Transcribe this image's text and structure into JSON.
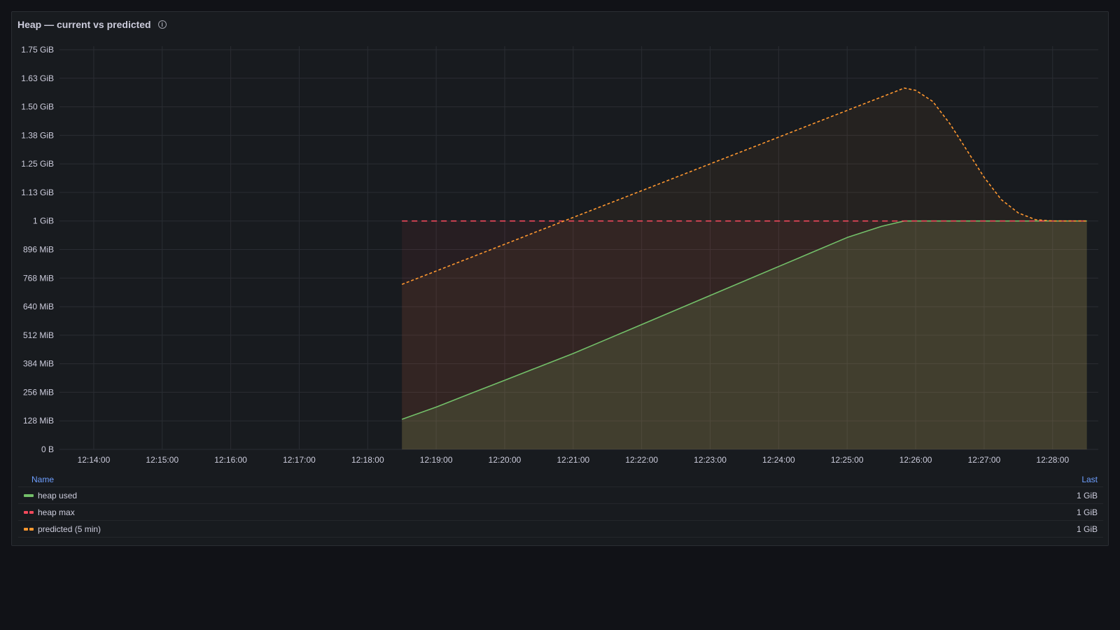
{
  "panel": {
    "title": "Heap — current vs predicted",
    "info_icon": "info-icon"
  },
  "legend": {
    "name_header": "Name",
    "last_header": "Last",
    "items": [
      {
        "name": "heap used",
        "last": "1 GiB",
        "color": "#73bf69",
        "style": "solid"
      },
      {
        "name": "heap max",
        "last": "1 GiB",
        "color": "#f2495c",
        "style": "dashed"
      },
      {
        "name": "predicted (5 min)",
        "last": "1 GiB",
        "color": "#ff9830",
        "style": "dashed"
      }
    ]
  },
  "chart_data": {
    "type": "line",
    "title": "Heap — current vs predicted",
    "y_unit": "MiB",
    "ylim": [
      0,
      1792
    ],
    "y_ticks": [
      {
        "value": 0,
        "label": "0 B"
      },
      {
        "value": 128,
        "label": "128 MiB"
      },
      {
        "value": 256,
        "label": "256 MiB"
      },
      {
        "value": 384,
        "label": "384 MiB"
      },
      {
        "value": 512,
        "label": "512 MiB"
      },
      {
        "value": 640,
        "label": "640 MiB"
      },
      {
        "value": 768,
        "label": "768 MiB"
      },
      {
        "value": 896,
        "label": "896 MiB"
      },
      {
        "value": 1024,
        "label": "1 GiB"
      },
      {
        "value": 1152,
        "label": "1.13 GiB"
      },
      {
        "value": 1280,
        "label": "1.25 GiB"
      },
      {
        "value": 1408,
        "label": "1.38 GiB"
      },
      {
        "value": 1536,
        "label": "1.50 GiB"
      },
      {
        "value": 1664,
        "label": "1.63 GiB"
      },
      {
        "value": 1792,
        "label": "1.75 GiB"
      }
    ],
    "x_range": [
      "12:13:30",
      "12:28:40"
    ],
    "x_ticks": [
      "12:14:00",
      "12:15:00",
      "12:16:00",
      "12:17:00",
      "12:18:00",
      "12:19:00",
      "12:20:00",
      "12:21:00",
      "12:22:00",
      "12:23:00",
      "12:24:00",
      "12:25:00",
      "12:26:00",
      "12:27:00",
      "12:28:00"
    ],
    "grid": true,
    "legend_position": "bottom",
    "series": [
      {
        "name": "heap used",
        "color": "#73bf69",
        "dash": "none",
        "fill_opacity": 0.18,
        "x": [
          "12:18:30",
          "12:19:00",
          "12:19:30",
          "12:20:00",
          "12:20:30",
          "12:21:00",
          "12:21:30",
          "12:22:00",
          "12:22:30",
          "12:23:00",
          "12:23:30",
          "12:24:00",
          "12:24:30",
          "12:25:00",
          "12:25:30",
          "12:25:50",
          "12:26:00",
          "12:26:30",
          "12:27:00",
          "12:27:30",
          "12:28:00",
          "12:28:30"
        ],
        "y": [
          135,
          190,
          250,
          310,
          370,
          430,
          495,
          560,
          625,
          690,
          755,
          820,
          885,
          950,
          1000,
          1024,
          1024,
          1024,
          1024,
          1024,
          1024,
          1024
        ]
      },
      {
        "name": "heap max",
        "color": "#f2495c",
        "dash": "8,6",
        "fill_opacity": 0.07,
        "x": [
          "12:18:30",
          "12:28:30"
        ],
        "y": [
          1024,
          1024
        ]
      },
      {
        "name": "predicted (5 min)",
        "color": "#ff9830",
        "dash": "4,3",
        "fill_opacity": 0.06,
        "x": [
          "12:18:30",
          "12:19:00",
          "12:19:30",
          "12:20:00",
          "12:20:30",
          "12:21:00",
          "12:21:30",
          "12:22:00",
          "12:22:30",
          "12:23:00",
          "12:23:30",
          "12:24:00",
          "12:24:30",
          "12:25:00",
          "12:25:30",
          "12:25:50",
          "12:26:00",
          "12:26:15",
          "12:26:30",
          "12:26:45",
          "12:27:00",
          "12:27:15",
          "12:27:30",
          "12:27:45",
          "12:28:00",
          "12:28:15",
          "12:28:30"
        ],
        "y": [
          740,
          800,
          860,
          920,
          980,
          1040,
          1100,
          1160,
          1220,
          1280,
          1340,
          1400,
          1460,
          1520,
          1580,
          1620,
          1610,
          1560,
          1460,
          1340,
          1220,
          1120,
          1060,
          1030,
          1024,
          1024,
          1024
        ]
      }
    ]
  }
}
